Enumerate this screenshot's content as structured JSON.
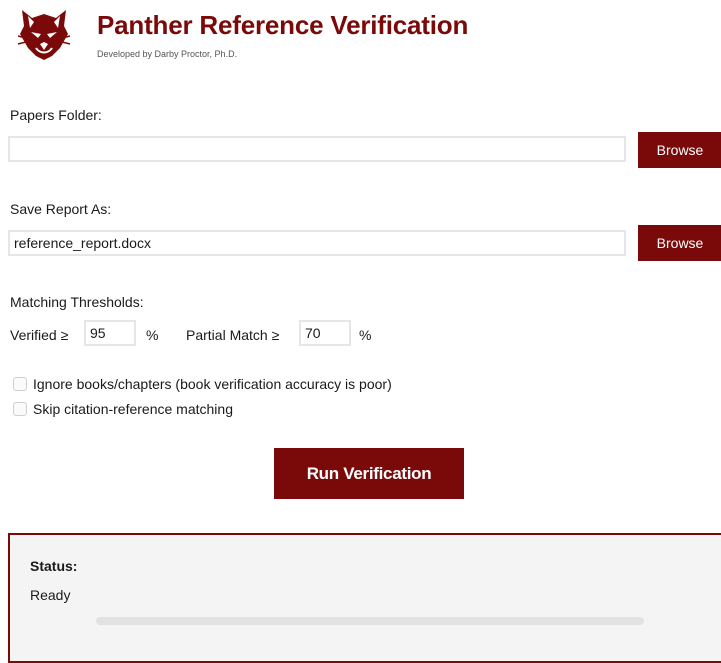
{
  "header": {
    "title": "Panther Reference Verification",
    "subtitle": "Developed by Darby Proctor, Ph.D."
  },
  "papers_folder": {
    "label": "Papers Folder:",
    "value": "",
    "browse_label": "Browse"
  },
  "save_report": {
    "label": "Save Report As:",
    "value": "reference_report.docx",
    "browse_label": "Browse"
  },
  "thresholds": {
    "heading": "Matching Thresholds:",
    "verified_label": "Verified ≥",
    "verified_value": "95",
    "verified_unit": "%",
    "partial_label": "Partial Match ≥",
    "partial_value": "70",
    "partial_unit": "%"
  },
  "options": [
    {
      "label": "Ignore books/chapters (book verification accuracy is poor)",
      "checked": false
    },
    {
      "label": "Skip citation-reference matching",
      "checked": false
    }
  ],
  "run_button_label": "Run Verification",
  "status": {
    "heading": "Status:",
    "text": "Ready",
    "progress": 0
  },
  "colors": {
    "brand": "#7a0a0a"
  },
  "icons": {
    "logo": "panther-head-icon"
  }
}
